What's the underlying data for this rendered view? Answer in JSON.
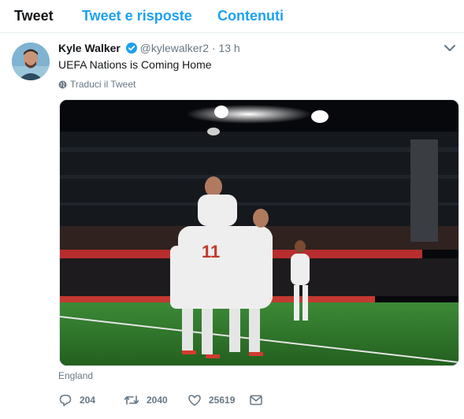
{
  "tabs": [
    {
      "label": "Tweet",
      "active": true
    },
    {
      "label": "Tweet e risposte",
      "active": false
    },
    {
      "label": "Contenuti",
      "active": false
    }
  ],
  "tweet": {
    "author_name": "Kyle Walker",
    "handle": "@kylewalker2",
    "separator": "·",
    "time": "13 h",
    "text": "UEFA Nations is Coming Home",
    "translate_label": "Traduci il Tweet",
    "location": "England",
    "reply_count": "204",
    "retweet_count": "2040",
    "like_count": "25619"
  },
  "colors": {
    "accent": "#1da1f2",
    "muted": "#657786",
    "text": "#14171a",
    "pitch": "#2f7a2d",
    "jersey": "#eeeeee"
  },
  "icons": [
    "verified-badge-icon",
    "chevron-down-icon",
    "globe-icon",
    "reply-icon",
    "retweet-icon",
    "like-icon",
    "direct-message-icon"
  ]
}
